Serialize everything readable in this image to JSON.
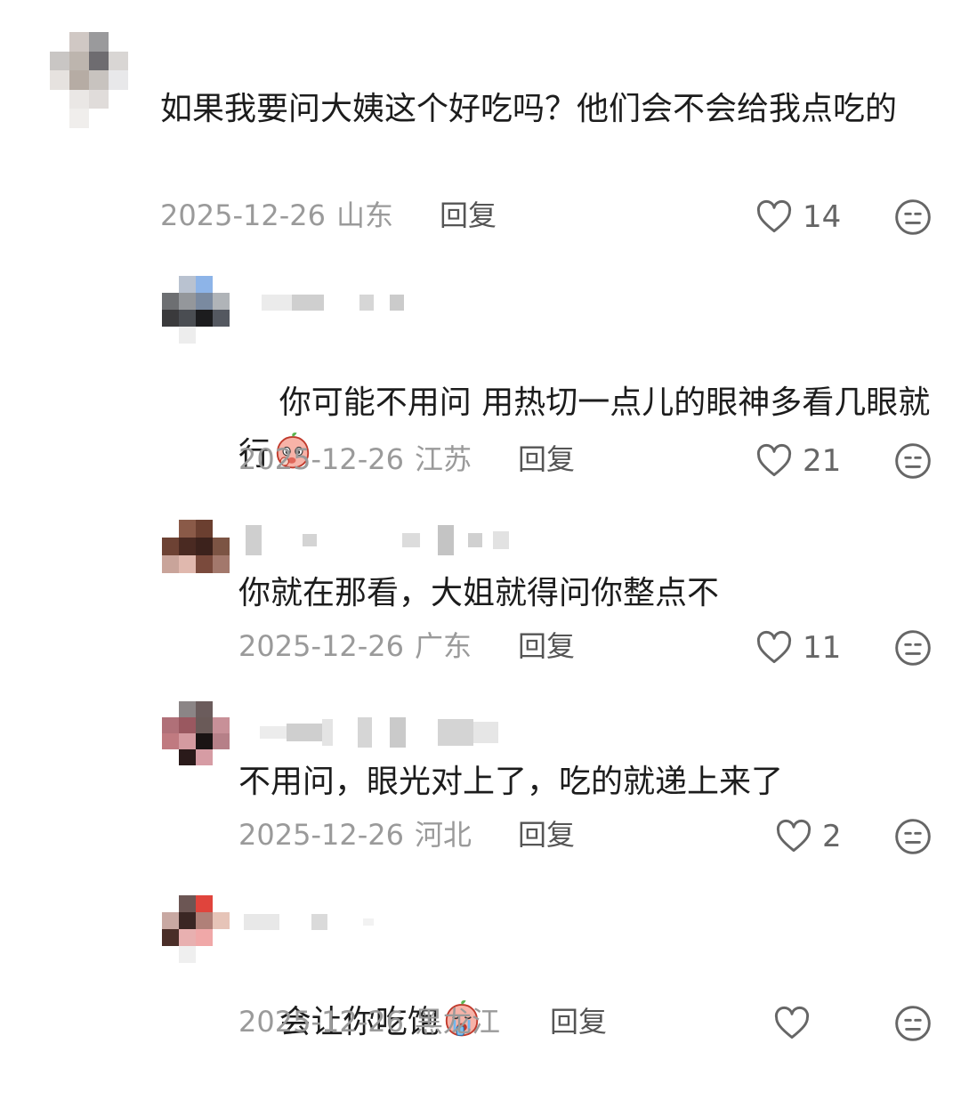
{
  "comments": [
    {
      "text": "如果我要问大姨这个好吃吗？他们会不会给我点吃的",
      "date": "2025-12-26",
      "location": "山东",
      "reply_label": "回复",
      "likes": "14",
      "sticker": ""
    },
    {
      "text": "你可能不用问 用热切一点儿的眼神多看几眼就行",
      "date": "2025-12-26",
      "location": "江苏",
      "reply_label": "回复",
      "likes": "21",
      "sticker": "peach-face-emoji"
    },
    {
      "text": "你就在那看，大姐就得问你整点不",
      "date": "2025-12-26",
      "location": "广东",
      "reply_label": "回复",
      "likes": "11",
      "sticker": ""
    },
    {
      "text": "不用问，眼光对上了，吃的就递上来了",
      "date": "2025-12-26",
      "location": "河北",
      "reply_label": "回复",
      "likes": "2",
      "sticker": ""
    },
    {
      "text": "会让你吃饱",
      "date": "2025-12-26",
      "location": "黑龙江",
      "reply_label": "回复",
      "likes": "",
      "sticker": "peach-crying-emoji"
    }
  ],
  "icons": {
    "like": "heart-outline-icon",
    "reaction": "neutral-face-icon"
  },
  "colors": {
    "text": "#1c1c1c",
    "meta": "#9a9a9a",
    "reply": "#555555",
    "icon": "#666666"
  }
}
